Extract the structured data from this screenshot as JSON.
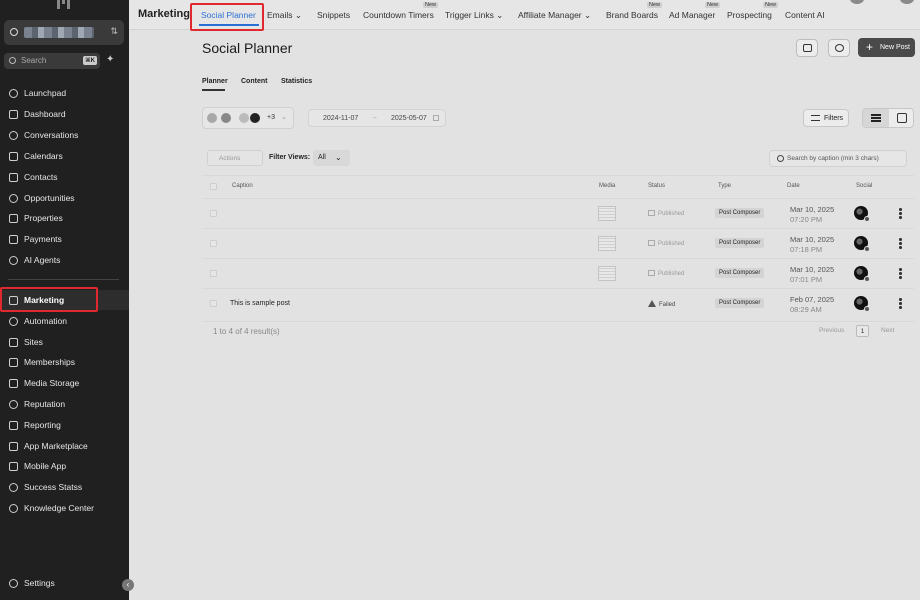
{
  "sidebar": {
    "account_name": "",
    "search_placeholder": "Search",
    "search_shortcut": "⌘K",
    "items": [
      {
        "label": "Launchpad",
        "icon": "launchpad-icon"
      },
      {
        "label": "Dashboard",
        "icon": "dashboard-icon"
      },
      {
        "label": "Conversations",
        "icon": "chat-icon"
      },
      {
        "label": "Calendars",
        "icon": "calendar-icon"
      },
      {
        "label": "Contacts",
        "icon": "contacts-icon"
      },
      {
        "label": "Opportunities",
        "icon": "opportunities-icon"
      },
      {
        "label": "Properties",
        "icon": "home-icon"
      },
      {
        "label": "Payments",
        "icon": "payments-icon"
      },
      {
        "label": "AI Agents",
        "icon": "sparkle-icon"
      },
      {
        "label": "Marketing",
        "icon": "send-icon",
        "active": true
      },
      {
        "label": "Automation",
        "icon": "automation-icon"
      },
      {
        "label": "Sites",
        "icon": "sites-icon"
      },
      {
        "label": "Memberships",
        "icon": "memberships-icon"
      },
      {
        "label": "Media Storage",
        "icon": "media-icon"
      },
      {
        "label": "Reputation",
        "icon": "star-icon"
      },
      {
        "label": "Reporting",
        "icon": "reporting-icon"
      },
      {
        "label": "App Marketplace",
        "icon": "grid-icon"
      },
      {
        "label": "Mobile App",
        "icon": "mobile-icon"
      },
      {
        "label": "Success Statss",
        "icon": "success-icon"
      },
      {
        "label": "Knowledge Center",
        "icon": "info-icon"
      }
    ],
    "settings_label": "Settings"
  },
  "topbar": {
    "title": "Marketing",
    "new_badge": "New",
    "tabs": [
      {
        "label": "Social Planner",
        "active": true
      },
      {
        "label": "Emails ⌄"
      },
      {
        "label": "Snippets"
      },
      {
        "label": "Countdown Timers",
        "new": true
      },
      {
        "label": "Trigger Links ⌄"
      },
      {
        "label": "Affiliate Manager ⌄"
      },
      {
        "label": "Brand Boards",
        "new": true
      },
      {
        "label": "Ad Manager",
        "new": true
      },
      {
        "label": "Prospecting",
        "new": true
      },
      {
        "label": "Content AI"
      }
    ]
  },
  "main": {
    "title": "Social Planner",
    "new_post_label": "New Post",
    "subtabs": [
      "Planner",
      "Content",
      "Statistics"
    ],
    "avatars_more": "+3",
    "date_start": "2024-11-07",
    "date_end": "2025-05-07",
    "date_arrow": "→",
    "filters_label": "Filters",
    "actions_label": "Actions",
    "filter_views_label": "Filter Views:",
    "filter_views_value": "All",
    "search_placeholder": "Search by caption (min 3 chars)"
  },
  "table": {
    "columns": [
      "Caption",
      "Media",
      "Status",
      "Type",
      "Date",
      "Social"
    ],
    "rows": [
      {
        "caption": "",
        "status": "Published",
        "type": "Post Composer",
        "date": "Mar 10, 2025",
        "time": "07:20 PM"
      },
      {
        "caption": "",
        "status": "Published",
        "type": "Post Composer",
        "date": "Mar 10, 2025",
        "time": "07:18 PM"
      },
      {
        "caption": "",
        "status": "Published",
        "type": "Post Composer",
        "date": "Mar 10, 2025",
        "time": "07:01 PM"
      },
      {
        "caption": "This is sample post",
        "status": "Failed",
        "type": "Post Composer",
        "date": "Feb 07, 2025",
        "time": "08:29 AM"
      }
    ],
    "result_count": "1 to 4 of 4 result(s)",
    "previous_label": "Previous",
    "page": "1",
    "next_label": "Next"
  },
  "colors": {
    "sidebar_bg": "#202020",
    "accent": "#2b6fd6",
    "highlight": "#e0282f"
  }
}
